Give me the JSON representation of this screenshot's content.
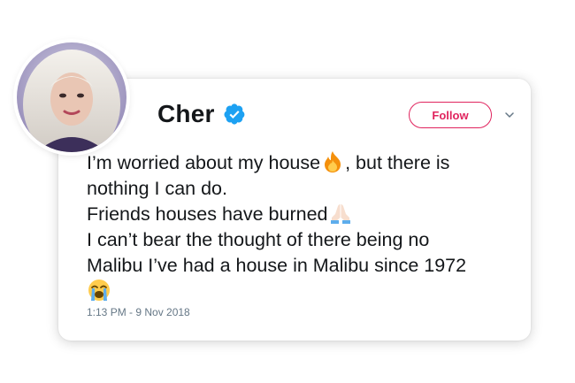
{
  "profile": {
    "display_name": "Cher",
    "verified": true,
    "avatar": "profile-photo"
  },
  "follow_button": {
    "label": "Follow",
    "color": "#e0245e"
  },
  "menu": {
    "icon": "chevron-down-icon"
  },
  "tweet": {
    "line1": "I’m worried about my house",
    "line1_emoji": "fire",
    "line1_rest": ", but there is",
    "line2": "nothing I can do.",
    "line3": "Friends houses have burned",
    "line3_emoji": "folded-hands",
    "line4": "I can’t bear the thought of there being no",
    "line5": "Malibu I’ve had a house in Malibu since 1972",
    "line6_emoji": "loudly-crying-face"
  },
  "timestamp": "1:13 PM - 9 Nov 2018",
  "colors": {
    "text": "#14171a",
    "muted": "#657786",
    "verified": "#1da1f2"
  }
}
